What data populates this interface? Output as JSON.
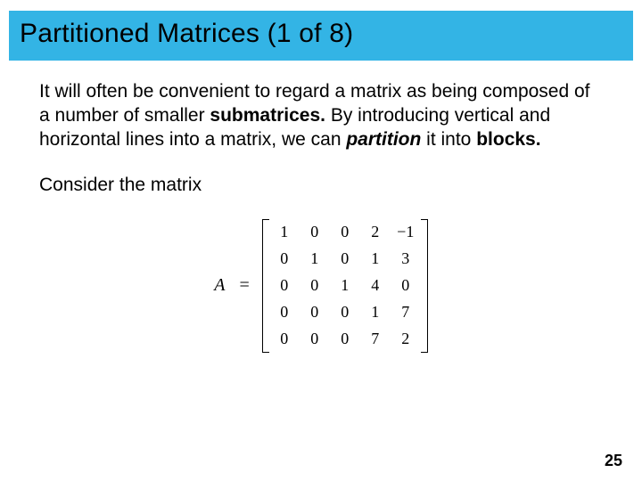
{
  "title": "Partitioned Matrices (1 of 8)",
  "p1_a": "It will often be convenient to regard a matrix as being composed of a number of smaller ",
  "p1_b": "submatrices.",
  "p1_c": " By introducing vertical and horizontal lines into a matrix, we can ",
  "p1_d": "partition",
  "p1_e": " it into ",
  "p1_f": "blocks.",
  "p2": "Consider the matrix",
  "matrix": {
    "label": "A",
    "eq": "=",
    "rows": [
      [
        "1",
        "0",
        "0",
        "2",
        "−1"
      ],
      [
        "0",
        "1",
        "0",
        "1",
        "3"
      ],
      [
        "0",
        "0",
        "1",
        "4",
        "0"
      ],
      [
        "0",
        "0",
        "0",
        "1",
        "7"
      ],
      [
        "0",
        "0",
        "0",
        "7",
        "2"
      ]
    ]
  },
  "page_number": "25"
}
